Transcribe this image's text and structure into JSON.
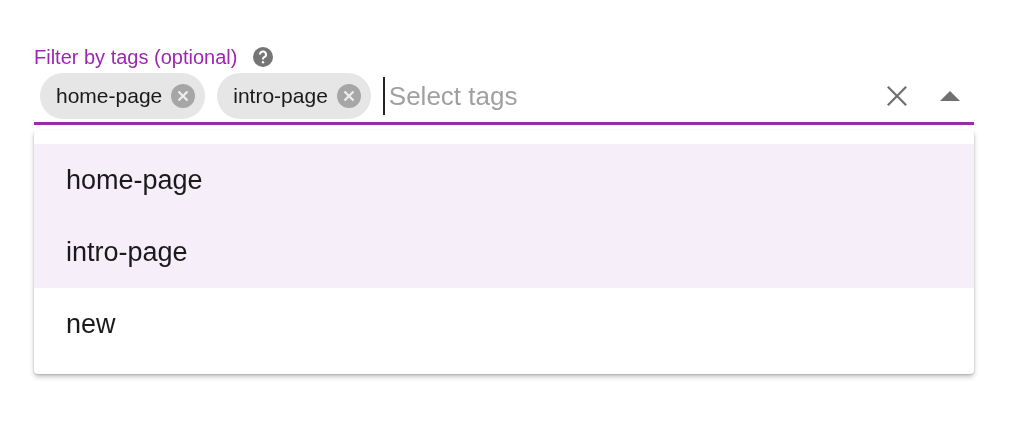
{
  "field": {
    "label": "Filter by tags (optional)",
    "placeholder": "Select tags",
    "focused": true,
    "expanded": true,
    "chips": [
      {
        "label": "home-page"
      },
      {
        "label": "intro-page"
      }
    ]
  },
  "options": [
    {
      "label": "home-page",
      "selected": true
    },
    {
      "label": "intro-page",
      "selected": true
    },
    {
      "label": "new",
      "selected": false
    }
  ]
}
